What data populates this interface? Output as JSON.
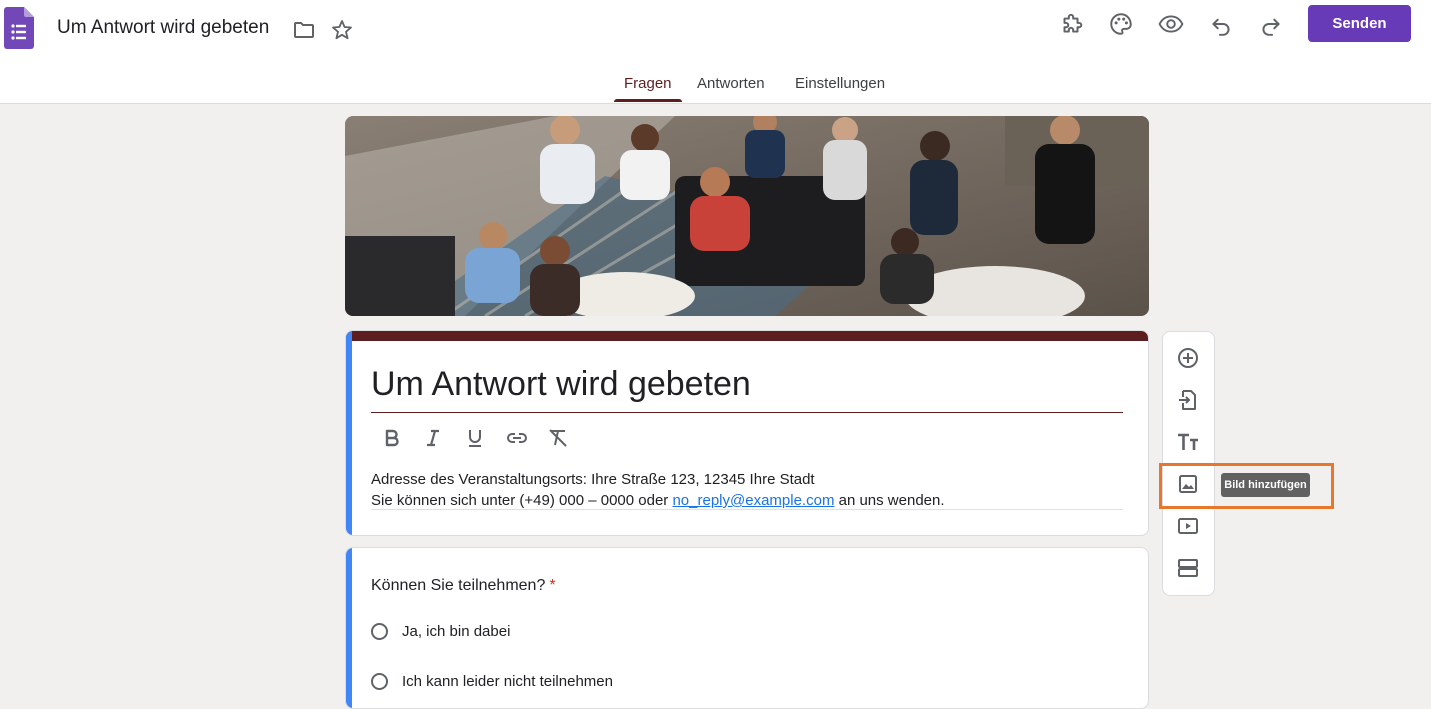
{
  "app": {
    "doc_title": "Um Antwort wird gebeten",
    "send_label": "Senden",
    "accent_color": "#673ab7",
    "theme_color": "#5c1e1e"
  },
  "toolbar_icons": [
    "addons-icon",
    "palette-icon",
    "preview-eye-icon",
    "undo-icon",
    "redo-icon"
  ],
  "tabs": [
    {
      "label": "Fragen",
      "active": true
    },
    {
      "label": "Antworten",
      "active": false
    },
    {
      "label": "Einstellungen",
      "active": false
    }
  ],
  "form": {
    "title": "Um Antwort wird gebeten",
    "format_icons": [
      "bold-icon",
      "italic-icon",
      "underline-icon",
      "link-icon",
      "clear-format-icon"
    ],
    "description": {
      "line1": "Adresse des Veranstaltungsorts: Ihre Straße 123, 12345 Ihre Stadt",
      "line2_prefix": "Sie können sich unter (+49) 000 – 0000 oder ",
      "email": "no_reply@example.com",
      "line2_suffix": " an uns wenden."
    }
  },
  "question": {
    "title": "Können Sie teilnehmen?",
    "required_mark": "*",
    "options": [
      "Ja, ich bin dabei",
      "Ich kann leider nicht teilnehmen"
    ]
  },
  "side_toolbar": {
    "items": [
      "add-question-icon",
      "import-questions-icon",
      "add-title-icon",
      "add-image-icon",
      "add-video-icon",
      "add-section-icon"
    ],
    "tooltip": "Bild hinzufügen"
  }
}
